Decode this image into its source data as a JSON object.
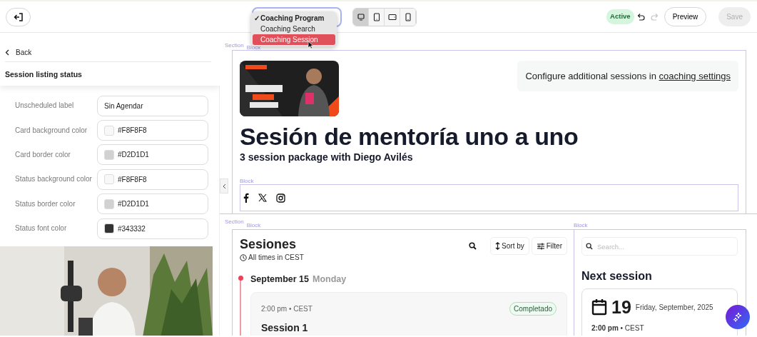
{
  "toolbar": {
    "page_menu_check": "✓",
    "page_menu": [
      {
        "label": "Coaching Program",
        "selected": true,
        "highlighted": false
      },
      {
        "label": "Coaching Search",
        "selected": false,
        "highlighted": false
      },
      {
        "label": "Coaching Session",
        "selected": false,
        "highlighted": true
      }
    ],
    "device_views": [
      {
        "kind": "desktop",
        "selected": true
      },
      {
        "kind": "tablet",
        "selected": false
      },
      {
        "kind": "tablet-landscape",
        "selected": false
      },
      {
        "kind": "phone",
        "selected": false
      }
    ],
    "status": "Active",
    "undo": {
      "disabled": false
    },
    "redo": {
      "disabled": true
    },
    "preview": "Preview",
    "save": {
      "label": "Save",
      "disabled": true
    }
  },
  "settings_panel": {
    "back": "Back",
    "title": "Session listing status",
    "fields": [
      {
        "label": "Unscheduled label",
        "kind": "text",
        "value": "Sin Agendar"
      },
      {
        "label": "Card background color",
        "kind": "color",
        "value": "#F8F8F8",
        "color": "#f8f8f8"
      },
      {
        "label": "Card border color",
        "kind": "color",
        "value": "#D2D1D1",
        "color": "#d2d1d1"
      },
      {
        "label": "Status background color",
        "kind": "color",
        "value": "#F8F8F8",
        "color": "#f8f8f8"
      },
      {
        "label": "Status border color",
        "kind": "color",
        "value": "#D2D1D1",
        "color": "#d2d1d1"
      },
      {
        "label": "Status font color",
        "kind": "color",
        "value": "#343332",
        "color": "#343332"
      }
    ]
  },
  "hero": {
    "section_label": "Section",
    "block_label": "Block",
    "callout": "Configure additional sessions in ",
    "callout_link": "coaching settings",
    "title": "Sesión de mentoría uno a uno",
    "subtitle": "3 session package with Diego Avilés",
    "social_block_label": "Block"
  },
  "sessions": {
    "section_label": "Section",
    "block_label": "Block",
    "title": "Sesiones",
    "timezone": "All times in CEST",
    "sort": "Sort by",
    "filter": "Filter",
    "day": {
      "date": "September 15",
      "weekday": "Monday"
    },
    "session": {
      "time": "2:00 pm • CEST",
      "status": "Completado",
      "title": "Session 1"
    }
  },
  "sidebar": {
    "block_label": "Block",
    "search_placeholder": "Search...",
    "next_title": "Next session",
    "next": {
      "day": "19",
      "date": "Friday, September, 2025",
      "time": "**2:00 pm** • CEST"
    }
  }
}
